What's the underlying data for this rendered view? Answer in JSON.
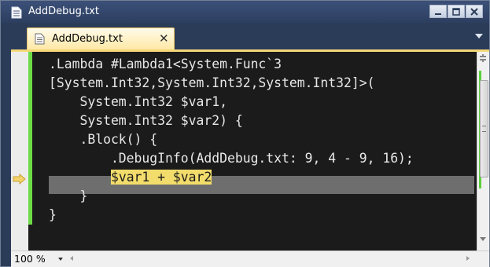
{
  "window": {
    "title": "AddDebug.txt",
    "icon": "document-icon",
    "controls": [
      "minimize-icon",
      "maximize-icon",
      "close-icon"
    ]
  },
  "tab": {
    "label": "AddDebug.txt",
    "icon": "document-icon",
    "close_glyph": "✕"
  },
  "editor": {
    "lines": [
      ".Lambda #Lambda1<System.Func`3",
      "[System.Int32,System.Int32,System.Int32]>(",
      "    System.Int32 $var1,",
      "    System.Int32 $var2) {",
      "    .Block() {",
      "        .DebugInfo(AddDebug.txt: 9, 4 - 9, 16);",
      "",
      "    }",
      "}"
    ],
    "current_line": {
      "indent": "        ",
      "text": "$var1 + $var2"
    },
    "current_line_marker": "arrow-right-icon"
  },
  "statusbar": {
    "zoom": "100 %"
  },
  "colors": {
    "titlebar": "#2d3f60",
    "tab_active": "#ffe8a6",
    "editor_bg": "#1b1b1b",
    "code_text": "#e8e8e8",
    "highlight_bg": "#f2dc6b",
    "current_line_bg": "#6e6e6e",
    "change_bar": "#6ddb48",
    "arrow": "#f5d36b"
  }
}
